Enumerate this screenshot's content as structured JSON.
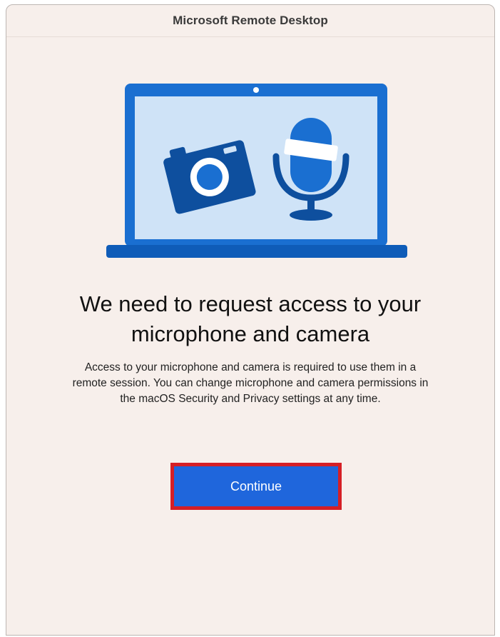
{
  "window": {
    "title": "Microsoft Remote Desktop"
  },
  "illustration": {
    "icons": [
      "laptop-icon",
      "camera-icon",
      "microphone-icon"
    ],
    "colors": {
      "frame": "#1a6fd1",
      "screen": "#cfe3f7",
      "dark": "#0e4f9e",
      "white": "#ffffff"
    }
  },
  "main": {
    "headline": "We need to request access to your microphone and camera",
    "description": "Access to your microphone and camera is required to use them in a remote session. You can change microphone and camera permissions in the macOS Security and Privacy settings at any time.",
    "continue_label": "Continue"
  },
  "colors": {
    "background": "#f7efeb",
    "button": "#1f66dc",
    "button_highlight": "#d51f26"
  }
}
